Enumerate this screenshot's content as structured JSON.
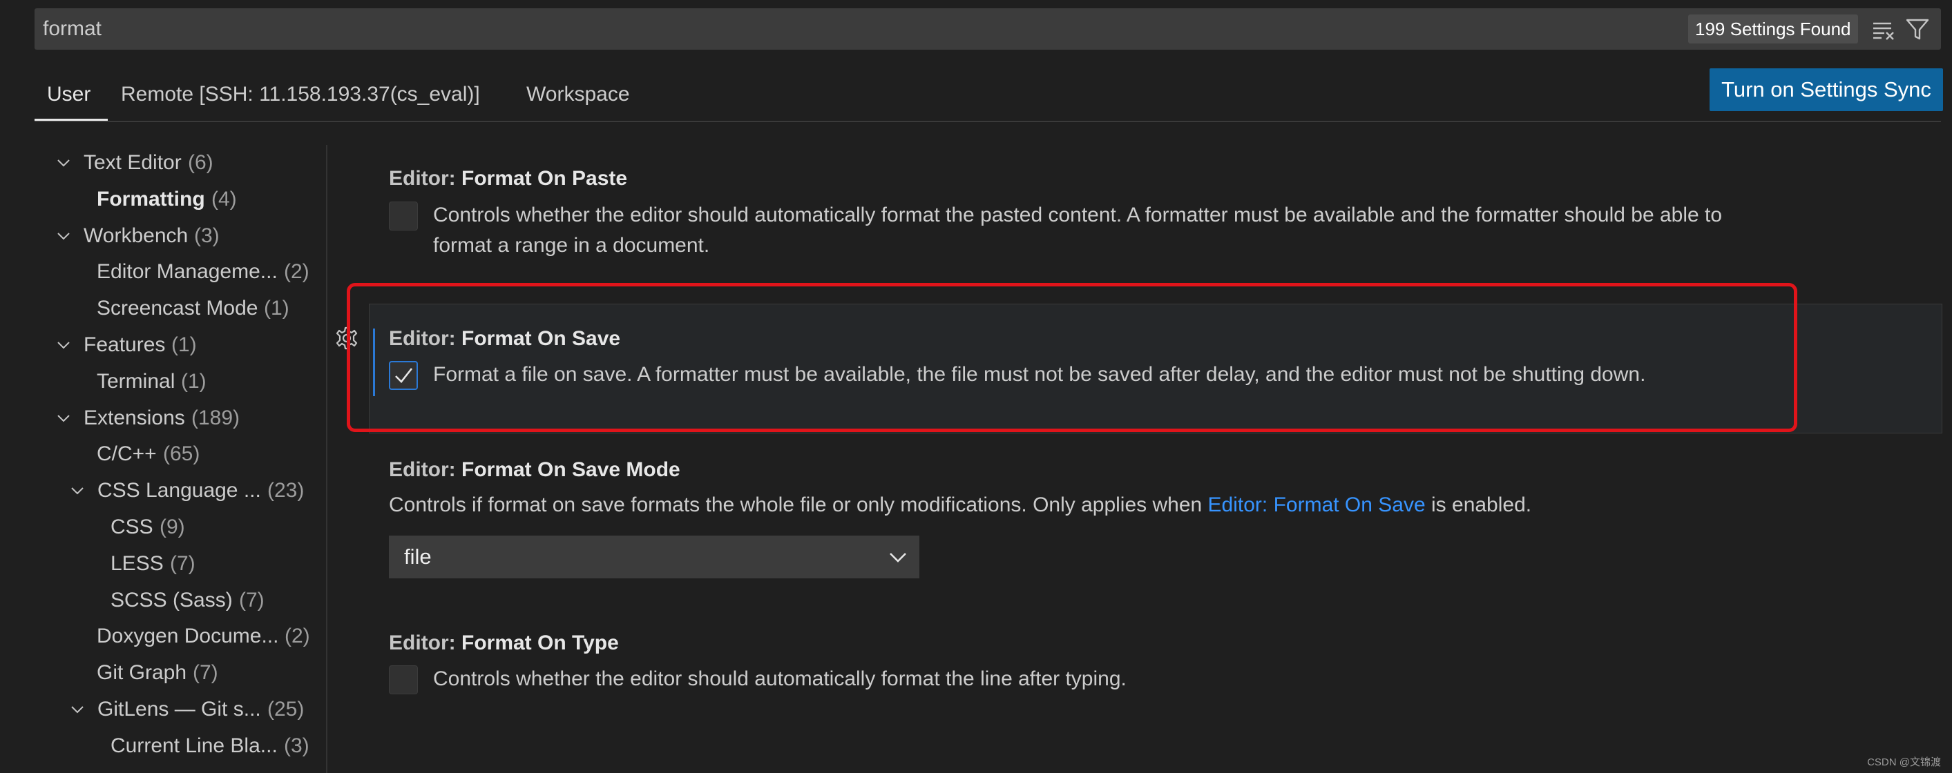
{
  "search": {
    "value": "format",
    "results_label": "199 Settings Found"
  },
  "tabs": [
    {
      "label": "User",
      "active": true
    },
    {
      "label": "Remote [SSH: 11.158.193.37(cs_eval)]",
      "active": false
    },
    {
      "label": "Workspace",
      "active": false
    }
  ],
  "sync_button": "Turn on Settings Sync",
  "toc": [
    {
      "label": "Text Editor",
      "count": "(6)",
      "expanded": true
    },
    {
      "label": "Formatting",
      "count": "(4)",
      "bold": true
    },
    {
      "label": "Workbench",
      "count": "(3)",
      "expanded": true
    },
    {
      "label": "Editor Manageme...",
      "count": "(2)"
    },
    {
      "label": "Screencast Mode",
      "count": "(1)"
    },
    {
      "label": "Features",
      "count": "(1)",
      "expanded": true
    },
    {
      "label": "Terminal",
      "count": "(1)"
    },
    {
      "label": "Extensions",
      "count": "(189)",
      "expanded": true
    },
    {
      "label": "C/C++",
      "count": "(65)"
    },
    {
      "label": "CSS Language ...",
      "count": "(23)",
      "expanded": true
    },
    {
      "label": "CSS",
      "count": "(9)"
    },
    {
      "label": "LESS",
      "count": "(7)"
    },
    {
      "label": "SCSS (Sass)",
      "count": "(7)"
    },
    {
      "label": "Doxygen Docume...",
      "count": "(2)"
    },
    {
      "label": "Git Graph",
      "count": "(7)"
    },
    {
      "label": "GitLens — Git s...",
      "count": "(25)",
      "expanded": true
    },
    {
      "label": "Current Line Bla...",
      "count": "(3)"
    }
  ],
  "settings": {
    "format_on_paste": {
      "category": "Editor: ",
      "name": "Format On Paste",
      "description_line1": "Controls whether the editor should automatically format the pasted content. A formatter must be available and the formatter should be able to",
      "description_line2": "format a range in a document.",
      "checked": false
    },
    "format_on_save": {
      "category": "Editor: ",
      "name": "Format On Save",
      "description": "Format a file on save. A formatter must be available, the file must not be saved after delay, and the editor must not be shutting down.",
      "checked": true
    },
    "format_on_save_mode": {
      "category": "Editor: ",
      "name": "Format On Save Mode",
      "description_before": "Controls if format on save formats the whole file or only modifications. Only applies when ",
      "description_link": "Editor: Format On Save",
      "description_after": " is enabled.",
      "value": "file"
    },
    "format_on_type": {
      "category": "Editor: ",
      "name": "Format On Type",
      "description": "Controls whether the editor should automatically format the line after typing.",
      "checked": false
    }
  },
  "watermark": "CSDN @文锦渡",
  "icons": {
    "clear": "clear-filter-icon",
    "filter": "filter-icon",
    "gear": "gear-icon",
    "chevron": "chevron-down-icon",
    "check": "check-icon"
  },
  "colors": {
    "accent": "#0e639c",
    "link": "#3794ff",
    "highlight": "#e0141a",
    "focus": "#2b79d6"
  }
}
